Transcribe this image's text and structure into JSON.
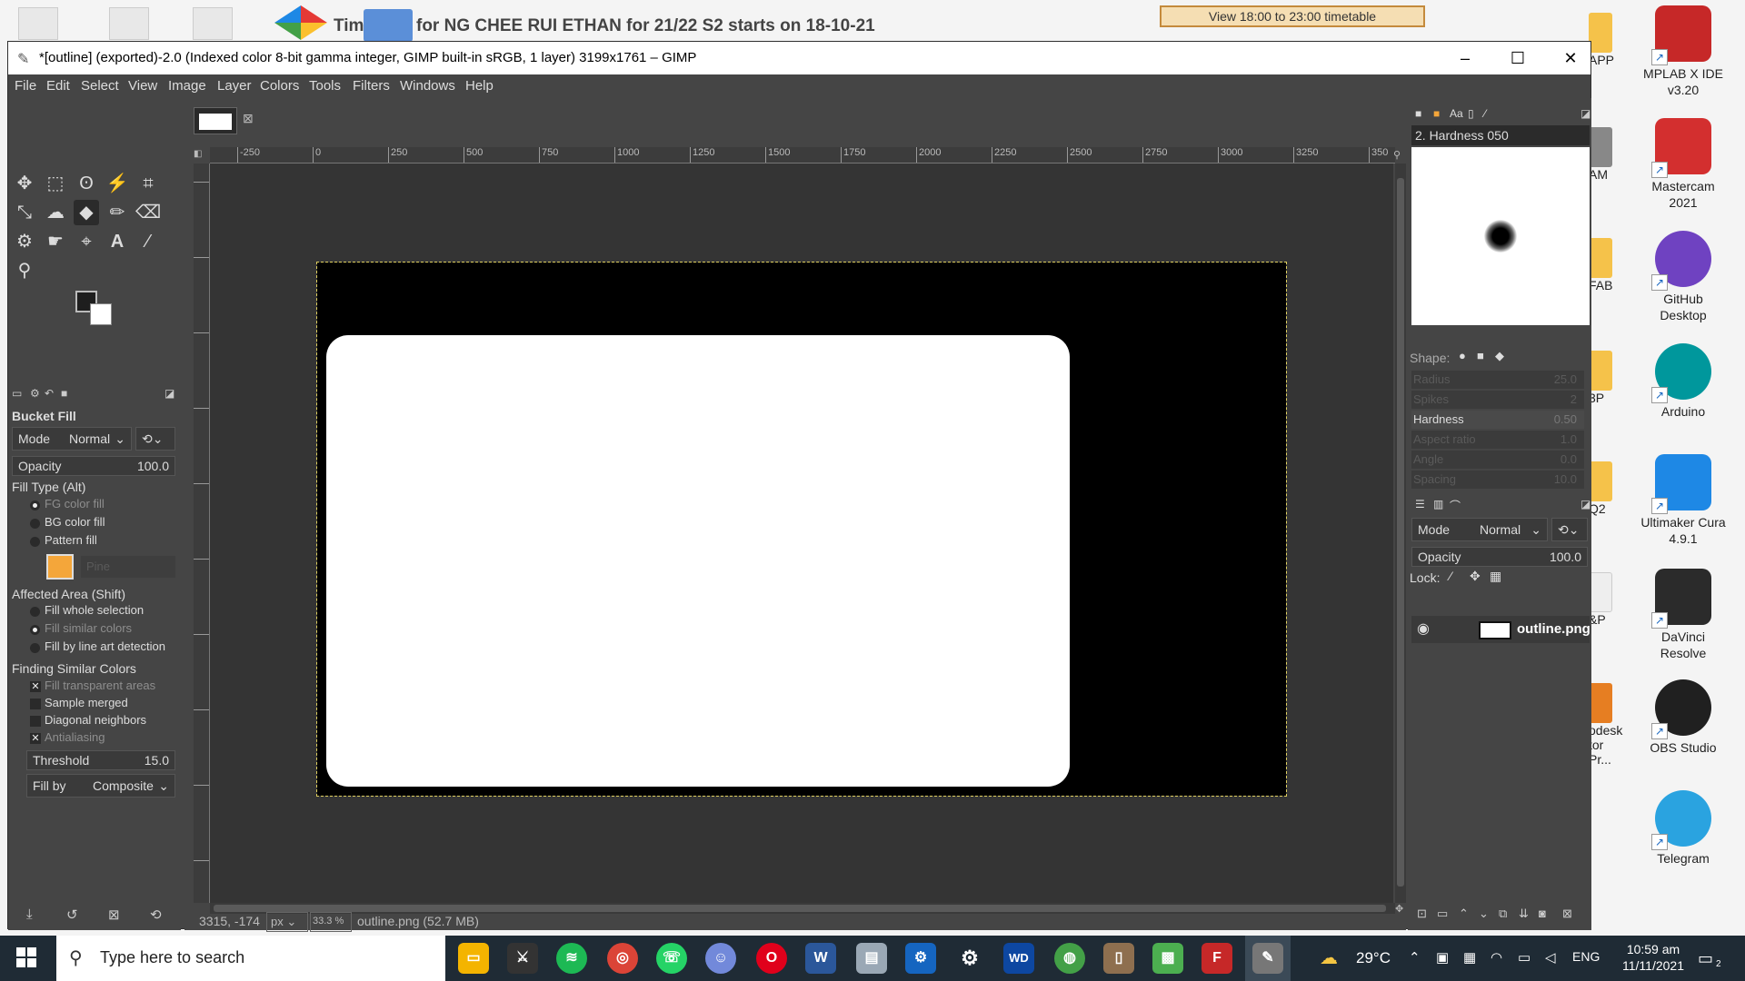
{
  "desktop": {
    "banner_tim": "Tim",
    "banner_text": "for NG CHEE RUI ETHAN for 21/22 S2 starts on 18-10-21",
    "timetable_button": "View 18:00 to 23:00 timetable",
    "icons": [
      {
        "label": "MPLAB X IDE v3.20",
        "color": "#c62828"
      },
      {
        "label": "Mastercam 2021",
        "color": "#d32f2f"
      },
      {
        "label": "GitHub Desktop",
        "color": "#6f42c1"
      },
      {
        "label": "Arduino",
        "color": "#00979c"
      },
      {
        "label": "Ultimaker Cura 4.9.1",
        "color": "#1e88e5"
      },
      {
        "label": "DaVinci Resolve",
        "color": "#2b2b2b"
      },
      {
        "label": "OBS Studio",
        "color": "#202020"
      },
      {
        "label": "Telegram",
        "color": "#2aa3e0"
      }
    ],
    "partial_labels": [
      "APP",
      "AM",
      "FAB",
      "3P",
      "Q2",
      "&P",
      "odesk tor Pr..."
    ]
  },
  "window": {
    "title": "*[outline] (exported)-2.0 (Indexed color 8-bit gamma integer, GIMP built-in sRGB, 1 layer) 3199x1761 – GIMP",
    "minimize": "–",
    "maximize": "☐",
    "close": "✕"
  },
  "menu": [
    "File",
    "Edit",
    "Select",
    "View",
    "Image",
    "Layer",
    "Colors",
    "Tools",
    "Filters",
    "Windows",
    "Help"
  ],
  "tool_options": {
    "title": "Bucket Fill",
    "mode_label": "Mode",
    "mode_value": "Normal",
    "opacity_label": "Opacity",
    "opacity_value": "100.0",
    "fill_type_title": "Fill Type  (Alt)",
    "fill_types": [
      "FG color fill",
      "BG color fill",
      "Pattern fill"
    ],
    "pattern_name": "Pine",
    "affected_title": "Affected Area  (Shift)",
    "affected": [
      "Fill whole selection",
      "Fill similar colors",
      "Fill by line art detection"
    ],
    "finding_title": "Finding Similar Colors",
    "finding": [
      "Fill transparent areas",
      "Sample merged",
      "Diagonal neighbors",
      "Antialiasing"
    ],
    "threshold_label": "Threshold",
    "threshold_value": "15.0",
    "fill_by_label": "Fill by",
    "fill_by_value": "Composite"
  },
  "ruler_labels": [
    "-250",
    "0",
    "250",
    "500",
    "750",
    "1000",
    "1250",
    "1500",
    "1750",
    "2000",
    "2250",
    "2500",
    "2750",
    "3000",
    "3250",
    "350"
  ],
  "status": {
    "coords": "3315, -174",
    "unit": "px",
    "zoom": "33.3 %",
    "file": "outline.png (52.7 MB)"
  },
  "brushes": {
    "title": "2. Hardness 050",
    "shape_label": "Shape:",
    "params": [
      {
        "label": "Radius",
        "value": "25.0"
      },
      {
        "label": "Spikes",
        "value": "2"
      },
      {
        "label": "Hardness",
        "value": "0.50"
      },
      {
        "label": "Aspect ratio",
        "value": "1.0"
      },
      {
        "label": "Angle",
        "value": "0.0"
      },
      {
        "label": "Spacing",
        "value": "10.0"
      }
    ]
  },
  "layers": {
    "mode_label": "Mode",
    "mode_value": "Normal",
    "opacity_label": "Opacity",
    "opacity_value": "100.0",
    "lock_label": "Lock:",
    "layer_name": "outline.png"
  },
  "taskbar": {
    "search_placeholder": "Type here to search",
    "weather": "29°C",
    "lang": "ENG",
    "time": "10:59 am",
    "date": "11/11/2021",
    "notifications": "2"
  }
}
